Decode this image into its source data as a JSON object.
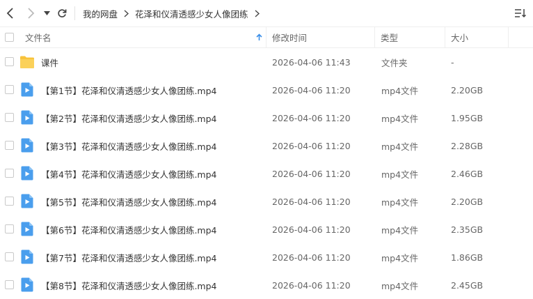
{
  "toolbar": {
    "back_icon": "chevron-left-icon",
    "forward_icon": "chevron-right-icon",
    "history_icon": "dropdown-triangle-icon",
    "refresh_icon": "refresh-icon",
    "sort_icon": "sort-list-icon"
  },
  "breadcrumb": [
    {
      "label": "我的网盘"
    },
    {
      "label": "花泽和仪清透感少女人像团练"
    }
  ],
  "table": {
    "headers": {
      "name": "文件名",
      "modified": "修改时间",
      "type": "类型",
      "size": "大小"
    },
    "sort_indicator": "up-arrow-icon",
    "rows": [
      {
        "name": "课件",
        "modified": "2026-04-06 11:43",
        "type": "文件夹",
        "size": "-",
        "icon": "folder-icon"
      },
      {
        "name": "【第1节】花泽和仪清透感少女人像团练.mp4",
        "modified": "2026-04-06 11:20",
        "type": "mp4文件",
        "size": "2.20GB",
        "icon": "video-file-icon"
      },
      {
        "name": "【第2节】花泽和仪清透感少女人像团练.mp4",
        "modified": "2026-04-06 11:20",
        "type": "mp4文件",
        "size": "1.95GB",
        "icon": "video-file-icon"
      },
      {
        "name": "【第3节】花泽和仪清透感少女人像团练.mp4",
        "modified": "2026-04-06 11:20",
        "type": "mp4文件",
        "size": "2.28GB",
        "icon": "video-file-icon"
      },
      {
        "name": "【第4节】花泽和仪清透感少女人像团练.mp4",
        "modified": "2026-04-06 11:20",
        "type": "mp4文件",
        "size": "2.46GB",
        "icon": "video-file-icon"
      },
      {
        "name": "【第5节】花泽和仪清透感少女人像团练.mp4",
        "modified": "2026-04-06 11:20",
        "type": "mp4文件",
        "size": "2.20GB",
        "icon": "video-file-icon"
      },
      {
        "name": "【第6节】花泽和仪清透感少女人像团练.mp4",
        "modified": "2026-04-06 11:20",
        "type": "mp4文件",
        "size": "2.35GB",
        "icon": "video-file-icon"
      },
      {
        "name": "【第7节】花泽和仪清透感少女人像团练.mp4",
        "modified": "2026-04-06 11:20",
        "type": "mp4文件",
        "size": "1.86GB",
        "icon": "video-file-icon"
      },
      {
        "name": "【第8节】花泽和仪清透感少女人像团练.mp4",
        "modified": "2026-04-06 11:20",
        "type": "mp4文件",
        "size": "2.45GB",
        "icon": "video-file-icon"
      }
    ]
  },
  "colors": {
    "accent": "#3b8fe8",
    "folder": "#f8c33b",
    "video": "#4a9eed"
  }
}
